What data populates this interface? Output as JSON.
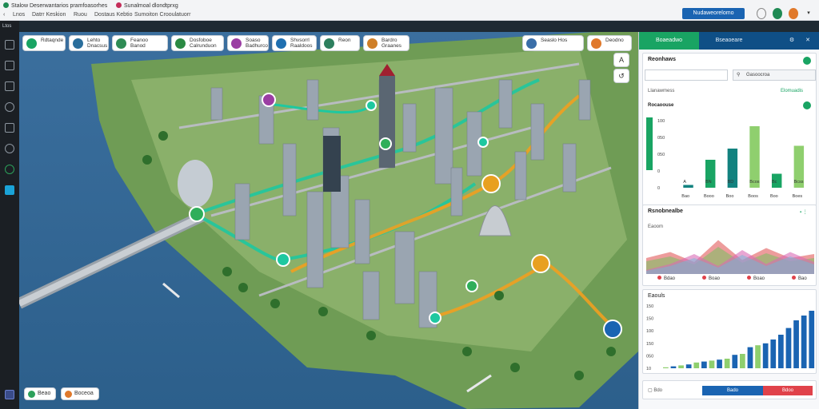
{
  "browser": {
    "tab1": "Stalow Deserwantarios pramfoasorhes",
    "tab2": "Sunalmoal dlondtprxg",
    "nav_labels": [
      "Lnos",
      "Datrr Keskion",
      "Ruou",
      "Dostaus Kebtio",
      "Sumoiton Crooulatuorr"
    ],
    "top_button": "Nudaweorelomo"
  },
  "rail": {
    "label": "Ltos"
  },
  "map": {
    "pills": [
      {
        "label": "Rdtaqnde",
        "color": "#19a463"
      },
      {
        "label": "Lehto\nDnacsus",
        "color": "#2a6e9c"
      },
      {
        "label": "Feanoo\nBanod",
        "color": "#2f8c55"
      },
      {
        "label": "Dosfoboe\nCalrunduon",
        "color": "#2b8a43"
      },
      {
        "label": "Soaso\nBadhurco",
        "color": "#9b3ea3"
      },
      {
        "label": "Shvsorrl\nRaaldoos",
        "color": "#1f6fb0"
      },
      {
        "label": "Reon",
        "color": "#2d7f5e"
      },
      {
        "label": "Bardro\nGraanes",
        "color": "#cf7f28"
      },
      {
        "label": "Seaslo  Hos",
        "color": "#3a6ea8"
      },
      {
        "label": "Deodno",
        "color": "#e0792b"
      }
    ],
    "btn_a": "A",
    "btn_b": "↺",
    "bottom_left": [
      {
        "label": "Beao",
        "color": "#2ca05a"
      },
      {
        "label": "Boceoa",
        "color": "#e0792b"
      }
    ]
  },
  "panel": {
    "tabs": [
      "Boaeadwo",
      "Bseaoeare"
    ],
    "header": "Reonhaws",
    "search_placeholder": "",
    "filter_label": "Gasoocroa",
    "subtitle": "Llanawmess",
    "subtitle_right": "Elomuadis",
    "card1_title": "Rocaoouse",
    "card2_title": "Rsnobnealbe",
    "card2_sub": "Eaoom",
    "card2_legend": [
      "Bdao",
      "Boao",
      "Boao",
      "Bao"
    ],
    "card3_title": "Eaouls",
    "footer_label": "Bdo",
    "footer_btn1": "Bado",
    "footer_btn2": "Bdoo",
    "colors": {
      "accent": "#0f4f86",
      "green": "#19a463",
      "teal": "#12827f",
      "lime": "#8fcf6e",
      "blue": "#1a64b2",
      "red": "#e0424a",
      "pink": "#d86bb5"
    }
  },
  "chart_data": [
    {
      "type": "bar",
      "title": "Rocaoouse",
      "categories": [
        "A",
        "BN",
        "BD",
        "Bcos",
        "Bc",
        "Bcss"
      ],
      "values": [
        0.5,
        5,
        7,
        11,
        2.5,
        7.5
      ],
      "ylim": [
        0,
        12
      ],
      "yticks": [
        "100",
        "050",
        "050",
        "0",
        "0"
      ],
      "xticklabels": [
        "Bao",
        "Booo",
        "Boo",
        "Boos",
        "Boo",
        "Boes"
      ],
      "series_colors": [
        "#12827f",
        "#19a463",
        "#12827f",
        "#8fcf6e",
        "#19a463",
        "#8fcf6e"
      ]
    },
    {
      "type": "area",
      "title": "Rsnobnealbe",
      "series": [
        {
          "values": [
            0.8,
            1.1,
            0.6,
            1.7,
            0.7,
            1.3,
            0.8,
            1.0
          ]
        },
        {
          "values": [
            0.2,
            0.5,
            1.0,
            0.4,
            1.2,
            0.5,
            1.1,
            0.6
          ]
        }
      ],
      "legend": [
        "Bdao",
        "Boao",
        "Boao",
        "Bao"
      ]
    },
    {
      "type": "bar",
      "title": "Eaouls",
      "yticks": [
        "150",
        "150",
        "100",
        "150",
        "050",
        "10"
      ],
      "values": [
        1,
        2,
        3,
        4,
        6,
        7,
        8,
        9,
        10,
        14,
        15,
        22,
        24,
        26,
        30,
        35,
        42,
        50,
        55,
        60
      ],
      "ylim": [
        0,
        65
      ]
    }
  ]
}
